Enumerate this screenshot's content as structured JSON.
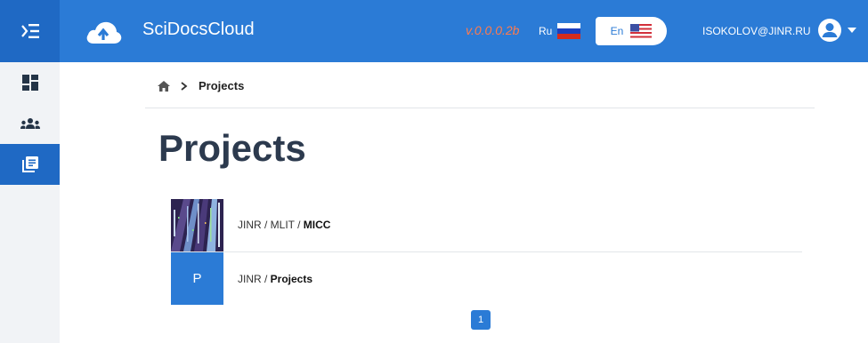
{
  "header": {
    "app_title": "SciDocsCloud",
    "version": "v.0.0.0.2b",
    "lang_ru": "Ru",
    "lang_en": "En",
    "user_email": "ISOKOLOV@JINR.RU"
  },
  "icons": {
    "menu_toggle": "indent-menu-icon",
    "logo": "cloud-upload-icon",
    "flag_ru": "russia-flag-icon",
    "flag_en": "usa-flag-icon",
    "user": "user-circle-icon",
    "user_caret": "caret-down-icon",
    "home": "home-icon",
    "chevron": "chevron-right-icon"
  },
  "sidebar": {
    "items": [
      {
        "name": "dashboard",
        "icon": "dashboard-icon"
      },
      {
        "name": "groups",
        "icon": "users-icon"
      },
      {
        "name": "projects",
        "icon": "documents-icon",
        "active": true
      }
    ]
  },
  "breadcrumb": {
    "current": "Projects"
  },
  "page": {
    "title": "Projects"
  },
  "projects": [
    {
      "path_prefix": "JINR / MLIT / ",
      "name": "MICC",
      "thumbnail": "image"
    },
    {
      "path_prefix": "JINR / ",
      "name": "Projects",
      "thumbnail_letter": "P"
    }
  ],
  "pagination": {
    "current": "1"
  },
  "colors": {
    "primary": "#2b7bd6",
    "primary_dark": "#1f69c4",
    "version": "#ff7b4d",
    "title": "#2c3a4e"
  }
}
